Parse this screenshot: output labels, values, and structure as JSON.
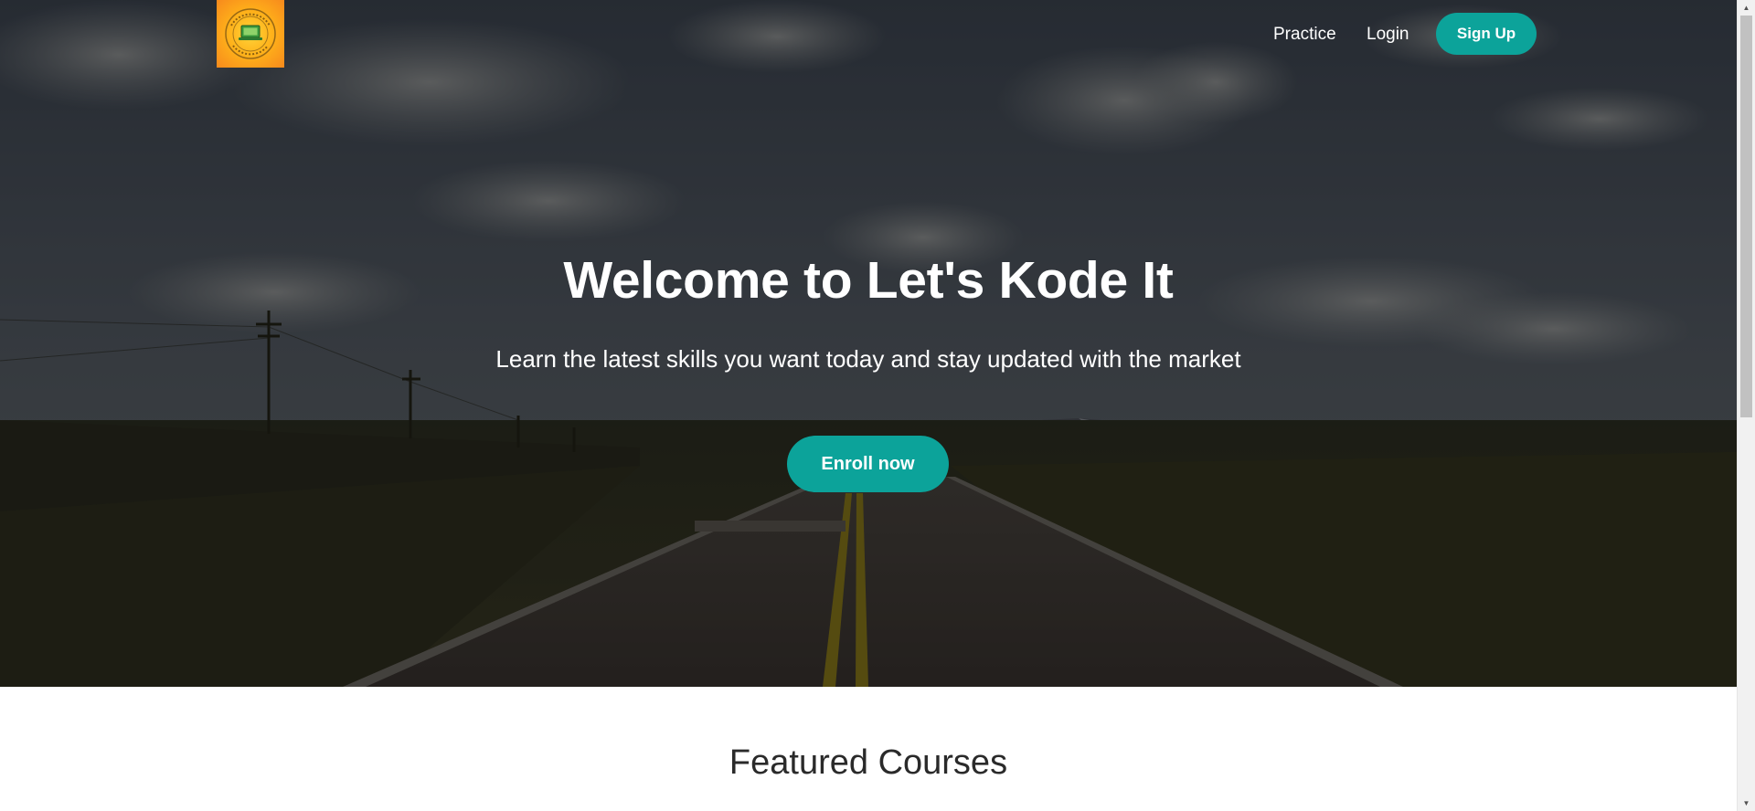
{
  "navbar": {
    "logo_alt": "Let's Kode It",
    "links": [
      {
        "label": "Practice"
      },
      {
        "label": "Login"
      }
    ],
    "signup_label": "Sign Up"
  },
  "hero": {
    "title": "Welcome to Let's Kode It",
    "subtitle": "Learn the latest skills you want today and stay updated with the market",
    "cta_label": "Enroll now",
    "background_description": "road-landscape-photo"
  },
  "featured": {
    "heading": "Featured Courses"
  },
  "colors": {
    "accent": "#0ca39a",
    "hero_overlay": "#000000",
    "text_light": "#ffffff",
    "text_dark": "#2a2a2a",
    "logo_orange": "#f7891c"
  }
}
